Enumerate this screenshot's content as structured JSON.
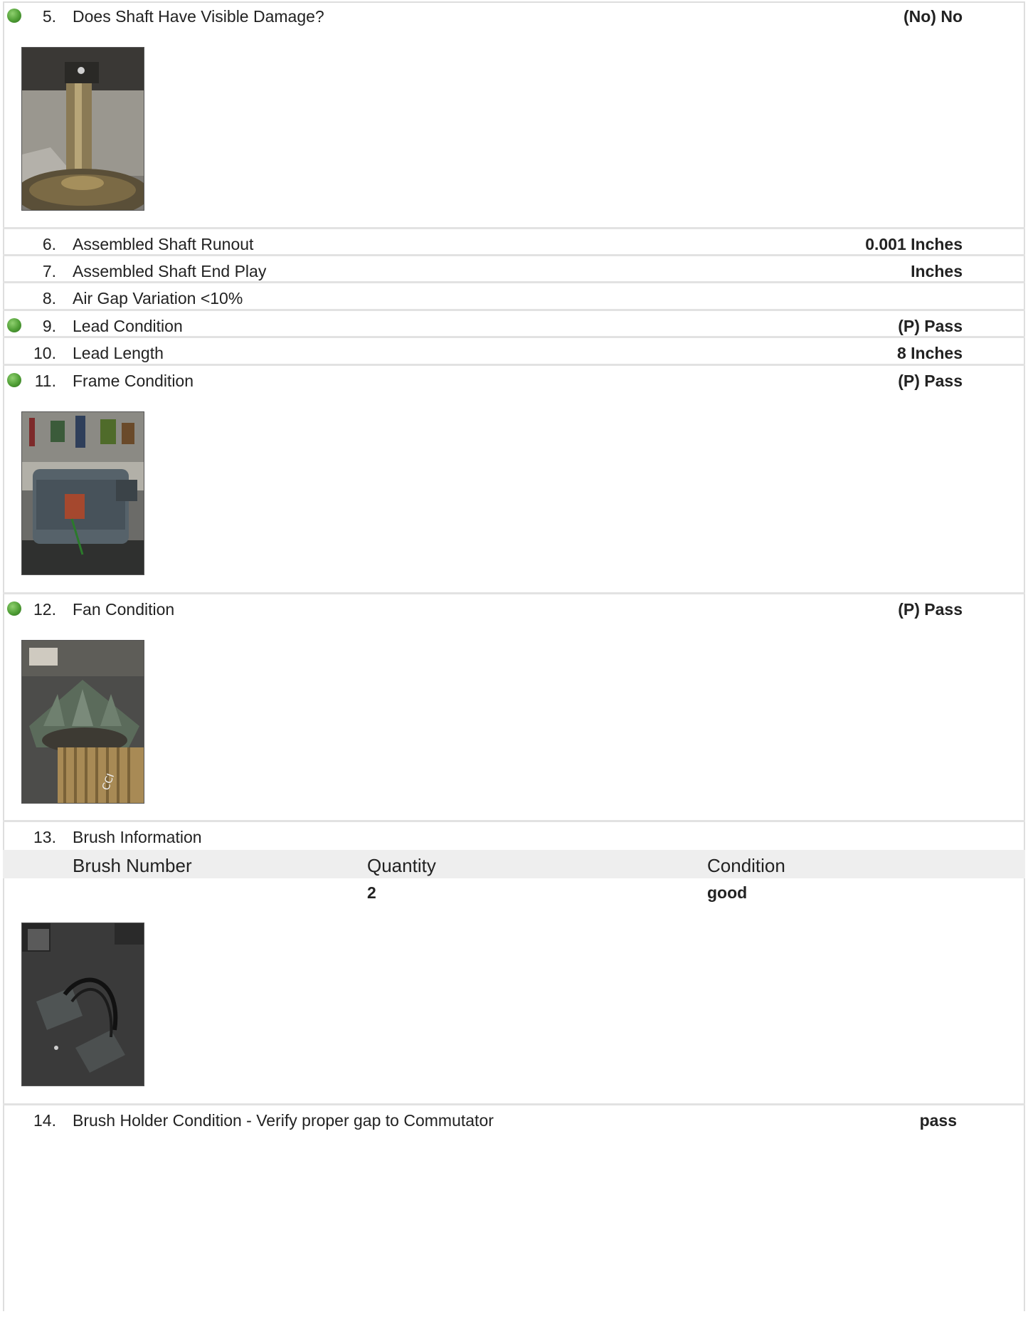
{
  "items": {
    "q5": {
      "num": "5.",
      "label": "Does Shaft Have Visible Damage?",
      "value": "(No) No"
    },
    "q6": {
      "num": "6.",
      "label": "Assembled Shaft Runout",
      "value": "0.001 Inches"
    },
    "q7": {
      "num": "7.",
      "label": "Assembled Shaft End Play",
      "value": "Inches"
    },
    "q8": {
      "num": "8.",
      "label": "Air Gap Variation <10%",
      "value": ""
    },
    "q9": {
      "num": "9.",
      "label": "Lead Condition",
      "value": "(P) Pass"
    },
    "q10": {
      "num": "10.",
      "label": "Lead Length",
      "value": "8 Inches"
    },
    "q11": {
      "num": "11.",
      "label": "Frame Condition",
      "value": "(P) Pass"
    },
    "q12": {
      "num": "12.",
      "label": "Fan Condition",
      "value": "(P) Pass"
    },
    "q13": {
      "num": "13.",
      "label": "Brush Information",
      "value": ""
    },
    "q14": {
      "num": "14.",
      "label": "Brush Holder Condition - Verify proper gap to Commutator",
      "value": "pass"
    }
  },
  "brush_table": {
    "headers": [
      "Brush Number",
      "Quantity",
      "Condition"
    ],
    "rows": [
      [
        "",
        "2",
        "good"
      ]
    ]
  },
  "colors": {
    "status_dot": "#4f9e35",
    "row_divider": "#e2e2e2",
    "table_header_bg": "#eeeeee"
  }
}
